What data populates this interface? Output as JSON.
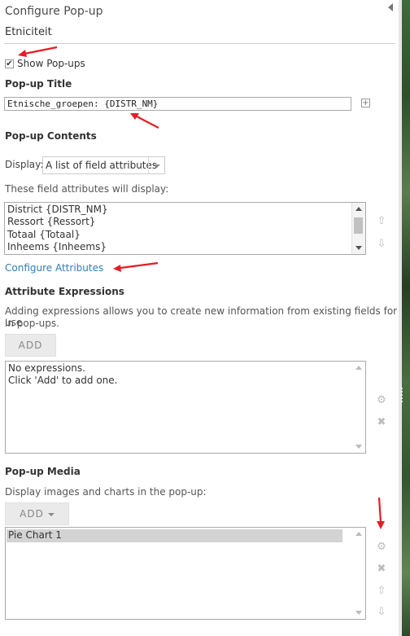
{
  "panel": {
    "title": "Configure Pop-up",
    "layer_name": "Etniciteit"
  },
  "show_popups": {
    "label": "Show Pop-ups",
    "checked": true
  },
  "popup_title": {
    "heading": "Pop-up Title",
    "value": "Etnische_groepen: {DISTR_NM}"
  },
  "popup_contents": {
    "heading": "Pop-up Contents",
    "display_label": "Display:",
    "display_value": "A list of field attributes",
    "fields_note": "These field attributes will display:",
    "fields": [
      "District {DISTR_NM}",
      "Ressort {Ressort}",
      "Totaal {Totaal}",
      "Inheems {Inheems}"
    ],
    "configure_link": "Configure Attributes"
  },
  "attribute_expressions": {
    "heading": "Attribute Expressions",
    "description_line1": "Adding expressions allows you to create new information from existing fields for use",
    "description_line2": "in pop-ups.",
    "add_label": "ADD",
    "empty_line1": "No expressions.",
    "empty_line2": "Click 'Add' to add one."
  },
  "popup_media": {
    "heading": "Pop-up Media",
    "description": "Display images and charts in the pop-up:",
    "add_label": "ADD",
    "items": [
      "Pie Chart 1"
    ]
  },
  "icons": {
    "plus": "+",
    "check": "✔",
    "move_up": "⇧",
    "move_down": "⇩",
    "gear": "⚙",
    "delete": "✖"
  },
  "colors": {
    "link": "#2d7fb8",
    "annotation_arrow": "#e41e26",
    "selected_row": "#d3d3d3"
  }
}
